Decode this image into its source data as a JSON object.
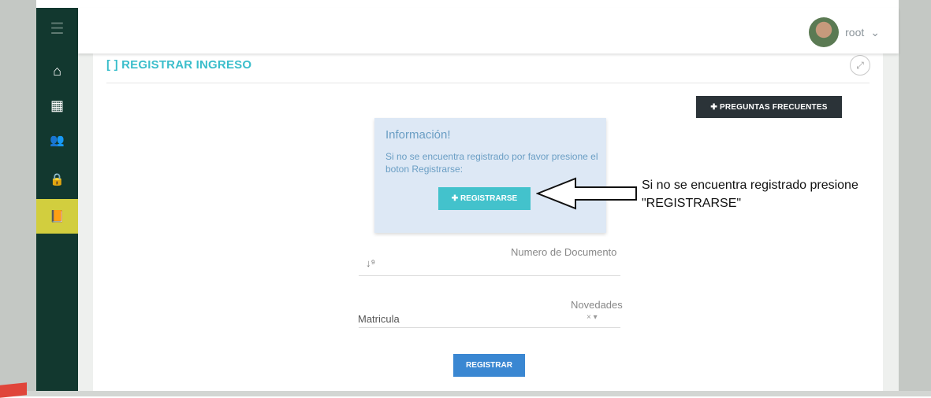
{
  "topbar": {
    "username": "root",
    "caret": "⌄"
  },
  "sidebar": {
    "items": [
      {
        "icon": "menu-icon",
        "glyph": "☰"
      },
      {
        "icon": "home-icon",
        "glyph": "⌂"
      },
      {
        "icon": "building-icon",
        "glyph": "▦"
      },
      {
        "icon": "users-icon",
        "glyph": "👥"
      },
      {
        "icon": "lock-icon",
        "glyph": "🔒"
      },
      {
        "icon": "book-icon",
        "glyph": "📙"
      }
    ]
  },
  "panel": {
    "title": "REGISTRAR INGRESO",
    "title_icon": "[ ]",
    "expand_glyph": "⤢",
    "faq_button": "✚ PREGUNTAS FRECUENTES"
  },
  "info": {
    "title": "Información!",
    "text": "Si no se encuentra registrado por favor presione el boton Registrarse:",
    "button": "✚ REGISTRARSE"
  },
  "form": {
    "document_label": "Numero de Documento",
    "sort_glyph": "↓⁹",
    "novedades_label": "Novedades",
    "novedades_value": "Matricula",
    "select_controls": "× ▾",
    "submit": "REGISTRAR"
  },
  "annotation": {
    "line1": "Si no se encuentra registrado presione",
    "line2": "\"REGISTRARSE\""
  },
  "colors": {
    "sidebar": "#12382f",
    "sidebar_active": "#d2ce3e",
    "accent": "#3bbecb",
    "faq_button": "#2b3338",
    "submit_button": "#3a87d2",
    "info_bg": "#dde8f5"
  }
}
